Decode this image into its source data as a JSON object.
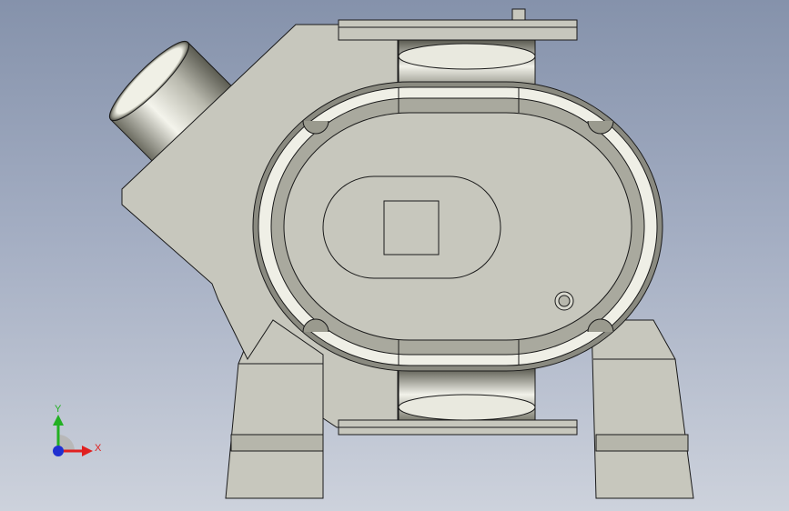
{
  "viewport": {
    "background_top": "#8592ab",
    "background_bottom": "#cdd2dc",
    "part_color": "#c7c7bd",
    "edge_color": "#1a1a1a"
  },
  "triad": {
    "x_label": "X",
    "y_label": "Y",
    "x_color": "#e02020",
    "y_color": "#22b022",
    "origin_color": "#2030d0"
  }
}
